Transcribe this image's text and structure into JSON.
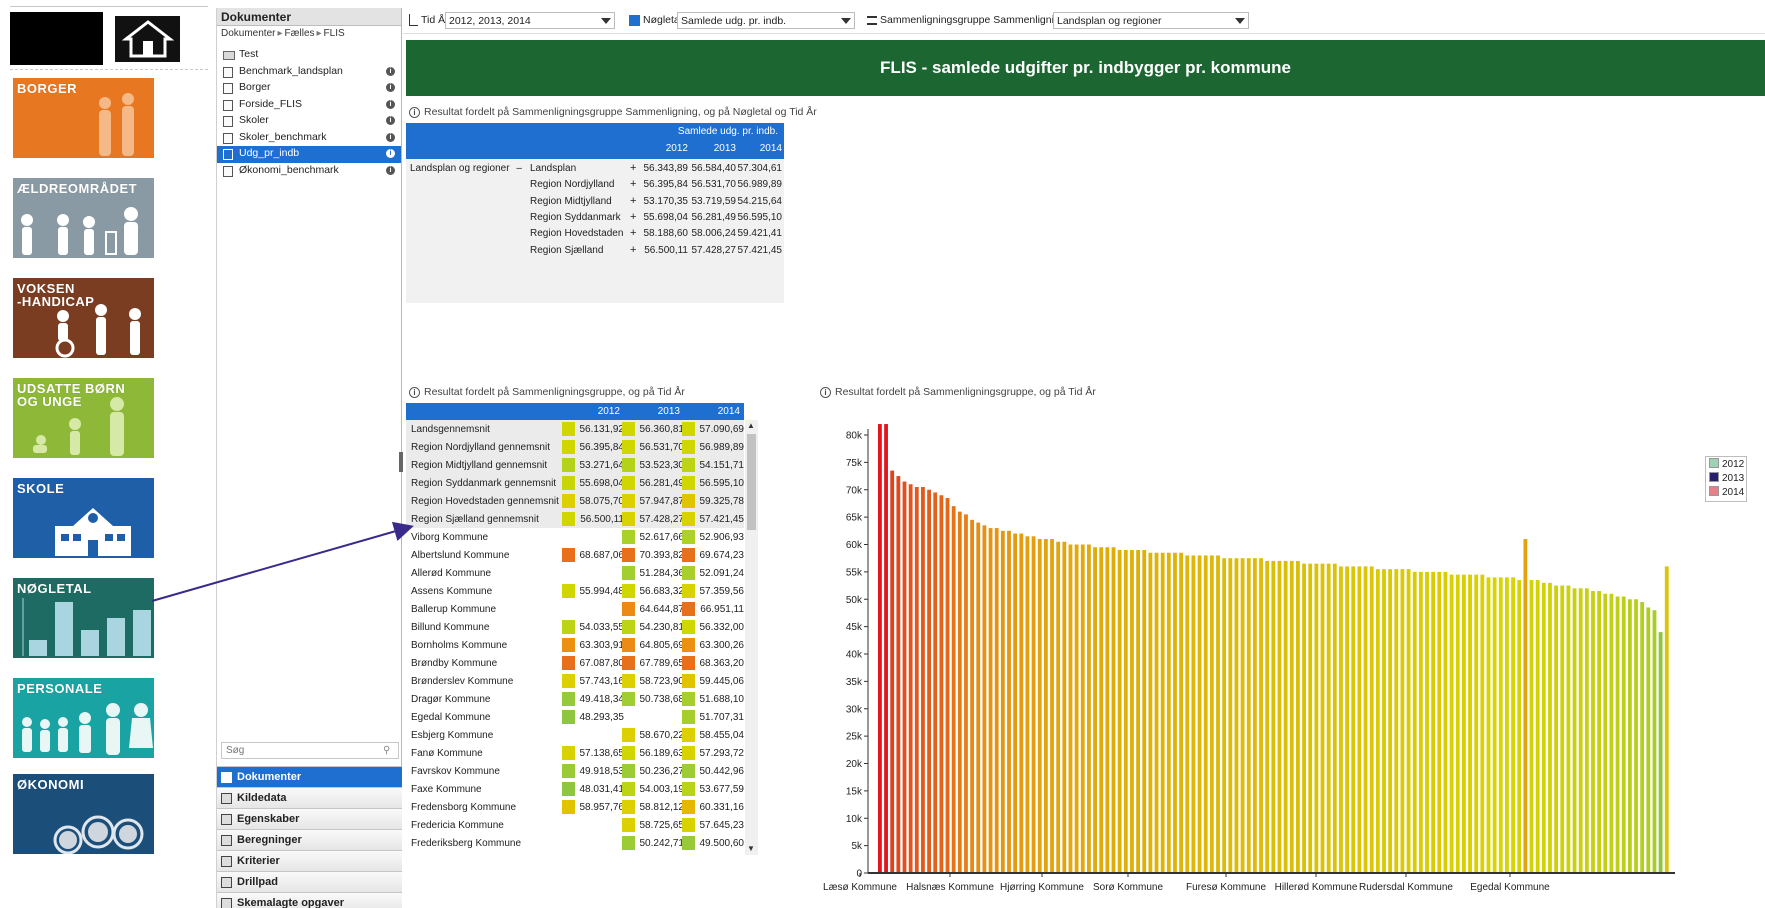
{
  "nav": {
    "header": "Dokumenter",
    "breadcrumb": [
      "Dokumenter",
      "Fælles",
      "FLIS"
    ],
    "documents": [
      {
        "label": "Test",
        "type": "folder"
      },
      {
        "label": "Benchmark_landsplan",
        "type": "doc"
      },
      {
        "label": "Borger",
        "type": "doc"
      },
      {
        "label": "Forside_FLIS",
        "type": "doc"
      },
      {
        "label": "Skoler",
        "type": "doc"
      },
      {
        "label": "Skoler_benchmark",
        "type": "doc"
      },
      {
        "label": "Udg_pr_indb",
        "type": "doc",
        "selected": true
      },
      {
        "label": "Økonomi_benchmark",
        "type": "doc"
      }
    ],
    "search_placeholder": "Søg",
    "tabs": [
      "Dokumenter",
      "Kildedata",
      "Egenskaber",
      "Beregninger",
      "Kriterier",
      "Drillpad",
      "Skemalagte opgaver"
    ]
  },
  "tiles": [
    {
      "label": "BORGER",
      "color": "#e87722"
    },
    {
      "label": "ÆLDREOMRÅDET",
      "color": "#8a9aa5"
    },
    {
      "label": "VOKSEN\n-HANDICAP",
      "color": "#7a3d22"
    },
    {
      "label": "UDSATTE BØRN\nOG UNGE",
      "color": "#8db838"
    },
    {
      "label": "SKOLE",
      "color": "#1f5fa8"
    },
    {
      "label": "NØGLETAL",
      "color": "#1e6b63"
    },
    {
      "label": "PERSONALE",
      "color": "#1aa3a3"
    },
    {
      "label": "ØKONOMI",
      "color": "#1b4f7a"
    }
  ],
  "toolbar": {
    "tid_label": "Tid År",
    "tid_value": "2012, 2013, 2014",
    "noegletal_label": "Nøgletal",
    "noegletal_value": "Samlede udg. pr. indb.",
    "sammen_label": "Sammenligningsgruppe Sammenligning",
    "sammen_value": "Landsplan og regioner"
  },
  "banner_title": "FLIS - samlede udgifter pr. indbygger pr. kommune",
  "pivot_top": {
    "title": "Resultat fordelt på Sammenligningsgruppe Sammenligning, og på Nøgletal og Tid År",
    "measure": "Samlede udg. pr. indb.",
    "years": [
      "2012",
      "2013",
      "2014"
    ],
    "group_label": "Landsplan og regioner",
    "group_toggle": "–",
    "rows": [
      {
        "name": "Landsplan",
        "values": [
          "56.343,89",
          "56.584,40",
          "57.304,61"
        ]
      },
      {
        "name": "Region Nordjylland",
        "values": [
          "56.395,84",
          "56.531,70",
          "56.989,89"
        ]
      },
      {
        "name": "Region Midtjylland",
        "values": [
          "53.170,35",
          "53.719,59",
          "54.215,64"
        ]
      },
      {
        "name": "Region Syddanmark",
        "values": [
          "55.698,04",
          "56.281,49",
          "56.595,10"
        ]
      },
      {
        "name": "Region Hovedstaden",
        "values": [
          "58.188,60",
          "58.006,24",
          "59.421,41"
        ]
      },
      {
        "name": "Region Sjælland",
        "values": [
          "56.500,11",
          "57.428,27",
          "57.421,45"
        ]
      }
    ]
  },
  "table_low": {
    "title": "Resultat fordelt på Sammenligningsgruppe, og på Tid År",
    "years": [
      "2012",
      "2013",
      "2014"
    ],
    "rows": [
      {
        "name": "Landsgennemsnit",
        "values": [
          "56.131,92",
          "56.360,81",
          "57.090,69"
        ],
        "colors": [
          "#cfd600",
          "#cfd600",
          "#cfd600"
        ]
      },
      {
        "name": "Region Nordjylland gennemsnit",
        "values": [
          "56.395,84",
          "56.531,70",
          "56.989,89"
        ],
        "colors": [
          "#cfd600",
          "#cfd600",
          "#cfd600"
        ]
      },
      {
        "name": "Region Midtjylland gennemsnit",
        "values": [
          "53.271,64",
          "53.523,30",
          "54.151,71"
        ],
        "colors": [
          "#b5d21a",
          "#b5d21a",
          "#bcd414"
        ]
      },
      {
        "name": "Region Syddanmark gennemsnit",
        "values": [
          "55.698,04",
          "56.281,49",
          "56.595,10"
        ],
        "colors": [
          "#c8d506",
          "#cfd600",
          "#cfd600"
        ]
      },
      {
        "name": "Region Hovedstaden gennemsnit",
        "values": [
          "58.075,70",
          "57.947,87",
          "59.325,78"
        ],
        "colors": [
          "#dcd000",
          "#dcd000",
          "#e0c400"
        ]
      },
      {
        "name": "Region Sjælland gennemsnit",
        "values": [
          "56.500,11",
          "57.428,27",
          "57.421,45"
        ],
        "colors": [
          "#cfd600",
          "#d8d300",
          "#d8d300"
        ]
      },
      {
        "name": "Viborg Kommune",
        "values": [
          "",
          "52.617,66",
          "52.906,93"
        ],
        "colors": [
          "",
          "#aad02a",
          "#aed126"
        ]
      },
      {
        "name": "Albertslund Kommune",
        "values": [
          "68.687,06",
          "70.393,82",
          "69.674,23"
        ],
        "colors": [
          "#e8701a",
          "#e8701a",
          "#e8701a"
        ]
      },
      {
        "name": "Allerød Kommune",
        "values": [
          "",
          "51.284,36",
          "52.091,24"
        ],
        "colors": [
          "",
          "#a2ce30",
          "#a8cf2c"
        ]
      },
      {
        "name": "Assens Kommune",
        "values": [
          "55.994,48",
          "56.683,32",
          "57.359,56"
        ],
        "colors": [
          "#cfd600",
          "#cfd600",
          "#d8d300"
        ]
      },
      {
        "name": "Ballerup Kommune",
        "values": [
          "",
          "64.644,87",
          "66.951,11"
        ],
        "colors": [
          "",
          "#eb8a14",
          "#e8701a"
        ]
      },
      {
        "name": "Billund Kommune",
        "values": [
          "54.033,55",
          "54.230,81",
          "56.332,00"
        ],
        "colors": [
          "#bcd414",
          "#bcd414",
          "#cfd600"
        ]
      },
      {
        "name": "Bornholms Kommune",
        "values": [
          "63.303,91",
          "64.805,69",
          "63.300,26"
        ],
        "colors": [
          "#eb9010",
          "#eb8a14",
          "#eb9010"
        ]
      },
      {
        "name": "Brøndby Kommune",
        "values": [
          "67.087,80",
          "67.789,65",
          "68.363,20"
        ],
        "colors": [
          "#e8701a",
          "#e8701a",
          "#e8701a"
        ]
      },
      {
        "name": "Brønderslev Kommune",
        "values": [
          "57.743,16",
          "58.723,90",
          "59.445,06"
        ],
        "colors": [
          "#dcd000",
          "#dcd000",
          "#e0c400"
        ]
      },
      {
        "name": "Dragør Kommune",
        "values": [
          "49.418,34",
          "50.738,68",
          "51.688,10"
        ],
        "colors": [
          "#96ca3a",
          "#a0cd32",
          "#a6cf2e"
        ]
      },
      {
        "name": "Egedal Kommune",
        "values": [
          "48.293,35",
          "",
          "51.707,31"
        ],
        "colors": [
          "#8ec640",
          "",
          "#a6cf2e"
        ]
      },
      {
        "name": "Esbjerg Kommune",
        "values": [
          "",
          "58.670,22",
          "58.455,04"
        ],
        "colors": [
          "",
          "#dcd000",
          "#dcd000"
        ]
      },
      {
        "name": "Fanø Kommune",
        "values": [
          "57.138,65",
          "56.189,63",
          "57.293,72"
        ],
        "colors": [
          "#d8d300",
          "#cfd600",
          "#d8d300"
        ]
      },
      {
        "name": "Favrskov Kommune",
        "values": [
          "49.918,53",
          "50.236,27",
          "50.442,96"
        ],
        "colors": [
          "#9acb36",
          "#9ccc34",
          "#9ecc34"
        ]
      },
      {
        "name": "Faxe Kommune",
        "values": [
          "48.031,41",
          "54.003,19",
          "53.677,59"
        ],
        "colors": [
          "#8ec640",
          "#bcd414",
          "#b8d318"
        ]
      },
      {
        "name": "Fredensborg Kommune",
        "values": [
          "58.957,76",
          "58.812,12",
          "60.331,16"
        ],
        "colors": [
          "#e0c400",
          "#dcd000",
          "#e4b800"
        ]
      },
      {
        "name": "Fredericia Kommune",
        "values": [
          "",
          "58.725,65",
          "57.645,23"
        ],
        "colors": [
          "",
          "#dcd000",
          "#d8d300"
        ]
      },
      {
        "name": "Frederiksberg Kommune",
        "values": [
          "",
          "50.242,71",
          "49.500,60"
        ],
        "colors": [
          "",
          "#9ccc34",
          "#98ca38"
        ]
      }
    ]
  },
  "chart_data": {
    "type": "bar",
    "title": "Resultat fordelt på Sammenligningsgruppe, og på Tid År",
    "ylim": [
      0,
      80000
    ],
    "yticks": [
      "0",
      "5k",
      "10k",
      "15k",
      "20k",
      "25k",
      "30k",
      "35k",
      "40k",
      "45k",
      "50k",
      "55k",
      "60k",
      "65k",
      "70k",
      "75k",
      "80k"
    ],
    "x_tick_labels": [
      "Læsø Kommune",
      "Halsnæs Kommune",
      "Hjørring Kommune",
      "Sorø Kommune",
      "Furesø Kommune",
      "Hillerød Kommune",
      "Rudersdal Kommune",
      "Egedal Kommune"
    ],
    "legend": [
      {
        "name": "2012",
        "color": "#9fd3b0"
      },
      {
        "name": "2013",
        "color": "#27206e"
      },
      {
        "name": "2014",
        "color": "#e8808a"
      }
    ],
    "grid": false,
    "legend_position": "right",
    "values": [
      82000,
      82000,
      73500,
      72500,
      71500,
      71000,
      70500,
      70500,
      70000,
      69500,
      69000,
      68500,
      67000,
      66000,
      65500,
      64500,
      64000,
      63500,
      63000,
      63000,
      62500,
      62500,
      62000,
      62000,
      61500,
      61500,
      61000,
      61000,
      61000,
      60500,
      60500,
      60000,
      60000,
      60000,
      60000,
      59500,
      59500,
      59500,
      59500,
      59000,
      59000,
      59000,
      59000,
      59000,
      58500,
      58500,
      58500,
      58500,
      58500,
      58500,
      58000,
      58000,
      58000,
      58000,
      58000,
      58000,
      57500,
      57500,
      57500,
      57500,
      57500,
      57500,
      57500,
      57000,
      57000,
      57000,
      57000,
      57000,
      57000,
      56500,
      56500,
      56500,
      56500,
      56500,
      56500,
      56000,
      56000,
      56000,
      56000,
      56000,
      56000,
      55500,
      55500,
      55500,
      55500,
      55500,
      55500,
      55000,
      55000,
      55000,
      55000,
      55000,
      55000,
      54500,
      54500,
      54500,
      54500,
      54500,
      54500,
      54000,
      54000,
      54000,
      54000,
      54000,
      53500,
      61000,
      53500,
      53500,
      53000,
      53000,
      52500,
      52500,
      52500,
      52000,
      52000,
      52000,
      51500,
      51500,
      51000,
      51000,
      50500,
      50500,
      50000,
      50000,
      49500,
      48500,
      48000,
      44000,
      56000
    ]
  }
}
